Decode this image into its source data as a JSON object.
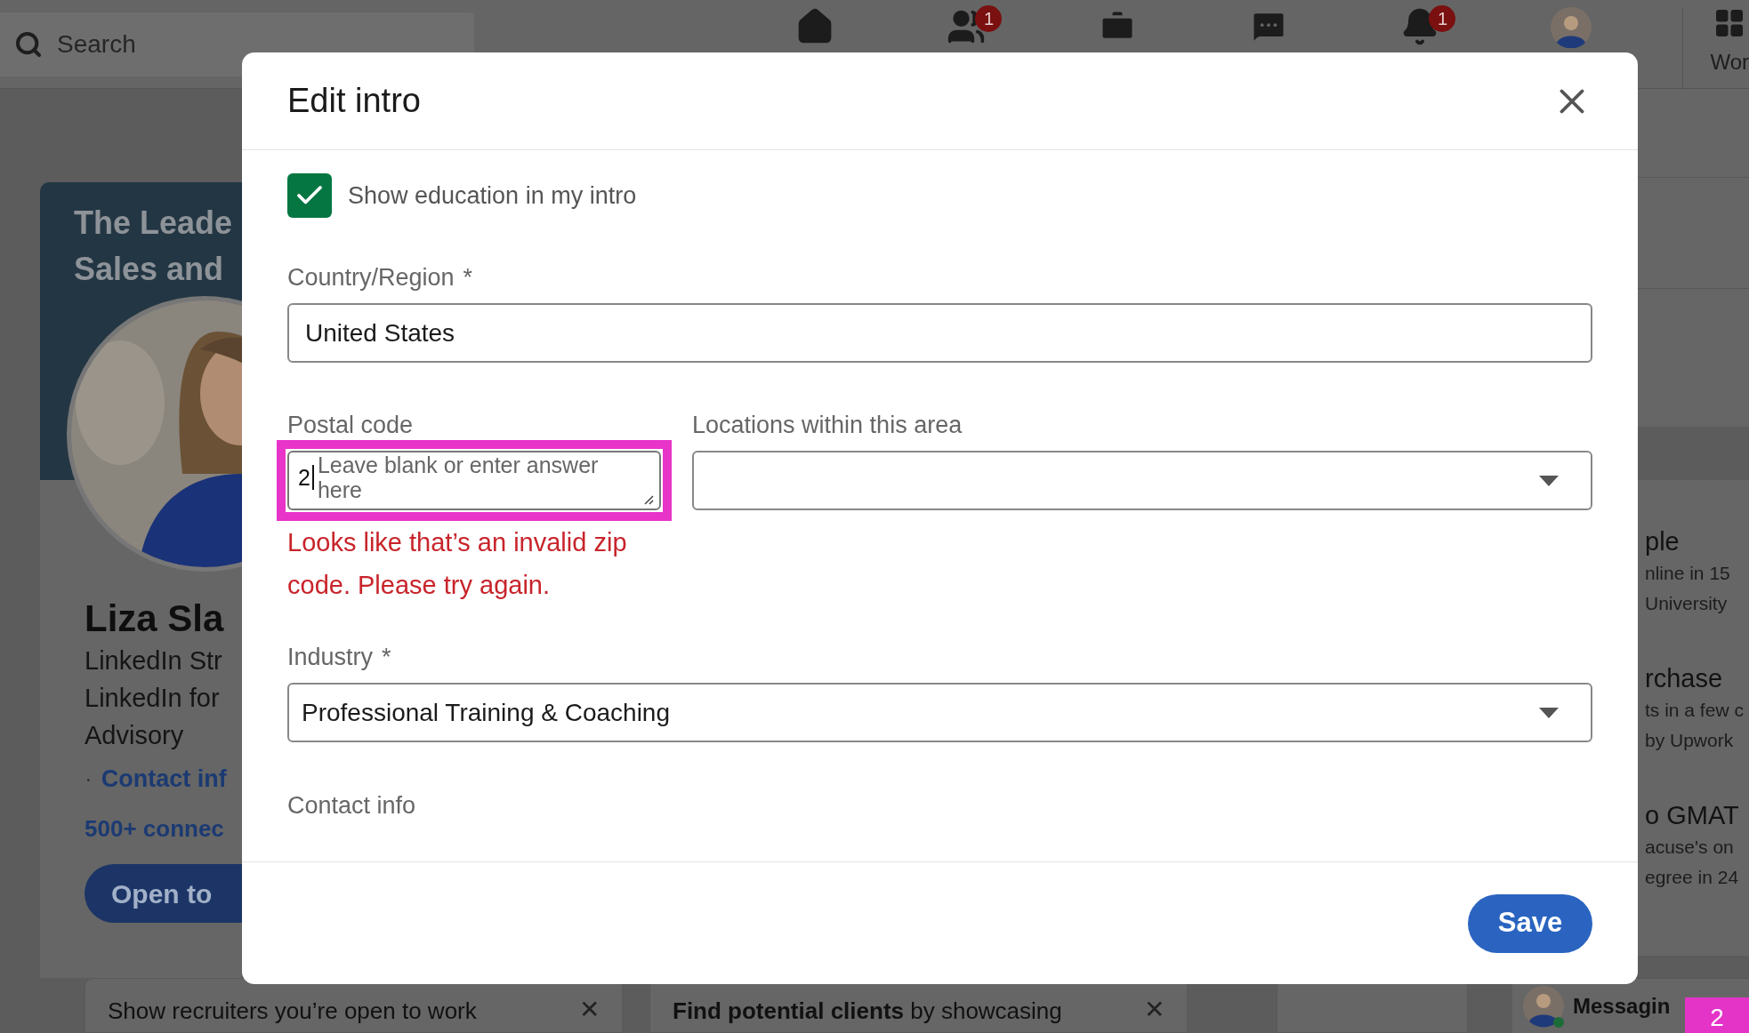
{
  "nav": {
    "search": {
      "placeholder": "Search"
    },
    "notification_badges": [
      "1",
      "1"
    ],
    "work_label": "Wor"
  },
  "profile_card": {
    "banner_lines": [
      "The Leade",
      "Sales and"
    ],
    "name": "Liza Sla",
    "headline_lines": [
      "LinkedIn Str",
      "LinkedIn for",
      "Advisory"
    ],
    "bullet": "·",
    "contact_link": "Contact inf",
    "connections": "500+ connec",
    "open_button": "Open to"
  },
  "suggestion_cards": [
    {
      "text": "Show recruiters you’re open to work",
      "close": "✕"
    },
    {
      "text": "**Find potential clients** by showcasing",
      "close": "✕"
    }
  ],
  "right_rail": {
    "items": [
      {
        "title": "ple",
        "lines": [
          "nline in 15",
          "University"
        ]
      },
      {
        "title": "rchase",
        "lines": [
          "ts in a few c",
          "by Upwork"
        ]
      },
      {
        "title": "o GMAT",
        "lines": [
          "acuse's on",
          "egree in 24"
        ]
      }
    ],
    "messaging": "Messagin"
  },
  "annotation_badge": "2",
  "modal": {
    "title": "Edit intro",
    "checkbox": {
      "label": "Show education in my intro",
      "checked": true
    },
    "country": {
      "label": "Country/Region",
      "required_mark": "*",
      "value": "United States"
    },
    "postal": {
      "label": "Postal code",
      "placeholder": "Leave blank or enter answer here",
      "value": "2",
      "highlighted": true,
      "error": "Looks like that’s an invalid zip code. Please try again."
    },
    "locations": {
      "label": "Locations within this area"
    },
    "industry": {
      "label": "Industry",
      "required_mark": "*",
      "value": "Professional Training & Coaching"
    },
    "contact_info": {
      "label": "Contact info"
    },
    "save": "Save"
  }
}
